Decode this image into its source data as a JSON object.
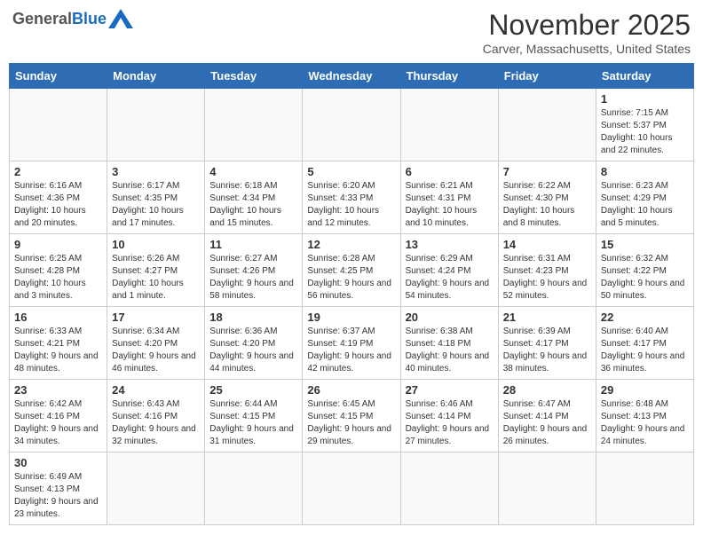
{
  "logo": {
    "general": "General",
    "blue": "Blue"
  },
  "header": {
    "title": "November 2025",
    "subtitle": "Carver, Massachusetts, United States"
  },
  "weekdays": [
    "Sunday",
    "Monday",
    "Tuesday",
    "Wednesday",
    "Thursday",
    "Friday",
    "Saturday"
  ],
  "weeks": [
    [
      {
        "day": "",
        "info": ""
      },
      {
        "day": "",
        "info": ""
      },
      {
        "day": "",
        "info": ""
      },
      {
        "day": "",
        "info": ""
      },
      {
        "day": "",
        "info": ""
      },
      {
        "day": "",
        "info": ""
      },
      {
        "day": "1",
        "info": "Sunrise: 7:15 AM\nSunset: 5:37 PM\nDaylight: 10 hours and 22 minutes."
      }
    ],
    [
      {
        "day": "2",
        "info": "Sunrise: 6:16 AM\nSunset: 4:36 PM\nDaylight: 10 hours and 20 minutes."
      },
      {
        "day": "3",
        "info": "Sunrise: 6:17 AM\nSunset: 4:35 PM\nDaylight: 10 hours and 17 minutes."
      },
      {
        "day": "4",
        "info": "Sunrise: 6:18 AM\nSunset: 4:34 PM\nDaylight: 10 hours and 15 minutes."
      },
      {
        "day": "5",
        "info": "Sunrise: 6:20 AM\nSunset: 4:33 PM\nDaylight: 10 hours and 12 minutes."
      },
      {
        "day": "6",
        "info": "Sunrise: 6:21 AM\nSunset: 4:31 PM\nDaylight: 10 hours and 10 minutes."
      },
      {
        "day": "7",
        "info": "Sunrise: 6:22 AM\nSunset: 4:30 PM\nDaylight: 10 hours and 8 minutes."
      },
      {
        "day": "8",
        "info": "Sunrise: 6:23 AM\nSunset: 4:29 PM\nDaylight: 10 hours and 5 minutes."
      }
    ],
    [
      {
        "day": "9",
        "info": "Sunrise: 6:25 AM\nSunset: 4:28 PM\nDaylight: 10 hours and 3 minutes."
      },
      {
        "day": "10",
        "info": "Sunrise: 6:26 AM\nSunset: 4:27 PM\nDaylight: 10 hours and 1 minute."
      },
      {
        "day": "11",
        "info": "Sunrise: 6:27 AM\nSunset: 4:26 PM\nDaylight: 9 hours and 58 minutes."
      },
      {
        "day": "12",
        "info": "Sunrise: 6:28 AM\nSunset: 4:25 PM\nDaylight: 9 hours and 56 minutes."
      },
      {
        "day": "13",
        "info": "Sunrise: 6:29 AM\nSunset: 4:24 PM\nDaylight: 9 hours and 54 minutes."
      },
      {
        "day": "14",
        "info": "Sunrise: 6:31 AM\nSunset: 4:23 PM\nDaylight: 9 hours and 52 minutes."
      },
      {
        "day": "15",
        "info": "Sunrise: 6:32 AM\nSunset: 4:22 PM\nDaylight: 9 hours and 50 minutes."
      }
    ],
    [
      {
        "day": "16",
        "info": "Sunrise: 6:33 AM\nSunset: 4:21 PM\nDaylight: 9 hours and 48 minutes."
      },
      {
        "day": "17",
        "info": "Sunrise: 6:34 AM\nSunset: 4:20 PM\nDaylight: 9 hours and 46 minutes."
      },
      {
        "day": "18",
        "info": "Sunrise: 6:36 AM\nSunset: 4:20 PM\nDaylight: 9 hours and 44 minutes."
      },
      {
        "day": "19",
        "info": "Sunrise: 6:37 AM\nSunset: 4:19 PM\nDaylight: 9 hours and 42 minutes."
      },
      {
        "day": "20",
        "info": "Sunrise: 6:38 AM\nSunset: 4:18 PM\nDaylight: 9 hours and 40 minutes."
      },
      {
        "day": "21",
        "info": "Sunrise: 6:39 AM\nSunset: 4:17 PM\nDaylight: 9 hours and 38 minutes."
      },
      {
        "day": "22",
        "info": "Sunrise: 6:40 AM\nSunset: 4:17 PM\nDaylight: 9 hours and 36 minutes."
      }
    ],
    [
      {
        "day": "23",
        "info": "Sunrise: 6:42 AM\nSunset: 4:16 PM\nDaylight: 9 hours and 34 minutes."
      },
      {
        "day": "24",
        "info": "Sunrise: 6:43 AM\nSunset: 4:16 PM\nDaylight: 9 hours and 32 minutes."
      },
      {
        "day": "25",
        "info": "Sunrise: 6:44 AM\nSunset: 4:15 PM\nDaylight: 9 hours and 31 minutes."
      },
      {
        "day": "26",
        "info": "Sunrise: 6:45 AM\nSunset: 4:15 PM\nDaylight: 9 hours and 29 minutes."
      },
      {
        "day": "27",
        "info": "Sunrise: 6:46 AM\nSunset: 4:14 PM\nDaylight: 9 hours and 27 minutes."
      },
      {
        "day": "28",
        "info": "Sunrise: 6:47 AM\nSunset: 4:14 PM\nDaylight: 9 hours and 26 minutes."
      },
      {
        "day": "29",
        "info": "Sunrise: 6:48 AM\nSunset: 4:13 PM\nDaylight: 9 hours and 24 minutes."
      }
    ],
    [
      {
        "day": "30",
        "info": "Sunrise: 6:49 AM\nSunset: 4:13 PM\nDaylight: 9 hours and 23 minutes."
      },
      {
        "day": "",
        "info": ""
      },
      {
        "day": "",
        "info": ""
      },
      {
        "day": "",
        "info": ""
      },
      {
        "day": "",
        "info": ""
      },
      {
        "day": "",
        "info": ""
      },
      {
        "day": "",
        "info": ""
      }
    ]
  ]
}
